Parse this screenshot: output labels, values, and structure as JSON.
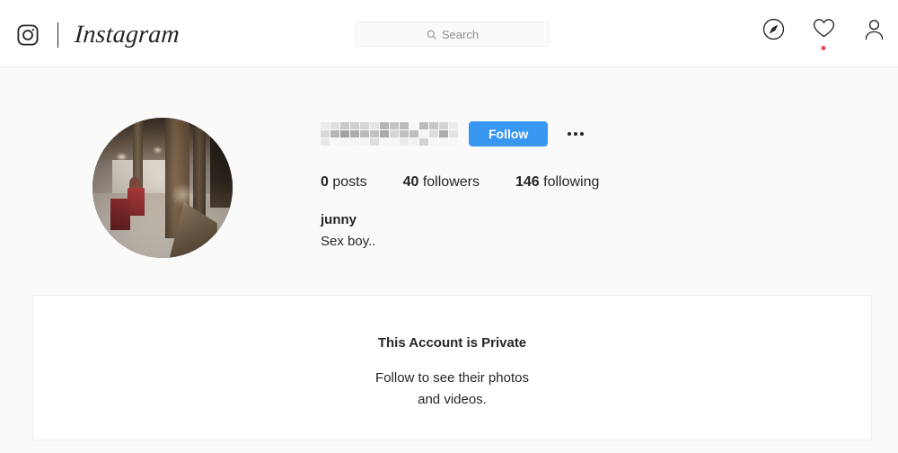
{
  "header": {
    "brand_name": "Instagram",
    "camera_icon": "instagram-camera-icon",
    "search": {
      "placeholder": "Search",
      "value": "",
      "icon": "search-icon"
    },
    "nav": [
      {
        "name": "explore",
        "icon": "compass-icon",
        "has_badge": false
      },
      {
        "name": "activity",
        "icon": "heart-icon",
        "has_badge": true
      },
      {
        "name": "profile",
        "icon": "person-icon",
        "has_badge": false
      }
    ]
  },
  "profile": {
    "avatar_alt": "profile-photo",
    "username_redacted": true,
    "follow_label": "Follow",
    "options_label": "More options",
    "stats": [
      {
        "value": "0",
        "label": " posts"
      },
      {
        "value": "40",
        "label": " followers"
      },
      {
        "value": "146",
        "label": " following"
      }
    ],
    "full_name": "junny",
    "bio": "Sex boy.."
  },
  "private_notice": {
    "title": "This Account is Private",
    "subtitle": "Follow to see their photos and videos."
  },
  "colors": {
    "accent_blue": "#3897f0",
    "notification_red": "#ed4956",
    "page_background": "#fafafa",
    "text_primary": "#262626",
    "text_secondary": "#8e8e8e"
  }
}
